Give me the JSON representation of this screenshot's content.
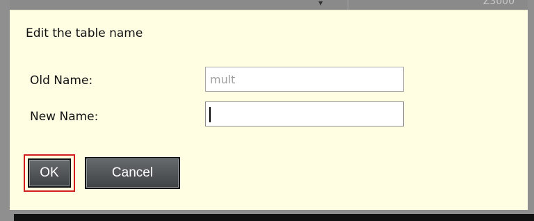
{
  "dialog": {
    "title": "Edit the table name",
    "old_name_label": "Old Name:",
    "new_name_label": "New Name:",
    "old_name_value": "mult",
    "new_name_value": "",
    "ok_label": "OK",
    "cancel_label": "Cancel"
  },
  "background": {
    "partial_text": "Z3000"
  },
  "colors": {
    "dialog_background": "#fffde2",
    "focus_outline": "#d11d1d",
    "button_background": "#4f5356"
  }
}
